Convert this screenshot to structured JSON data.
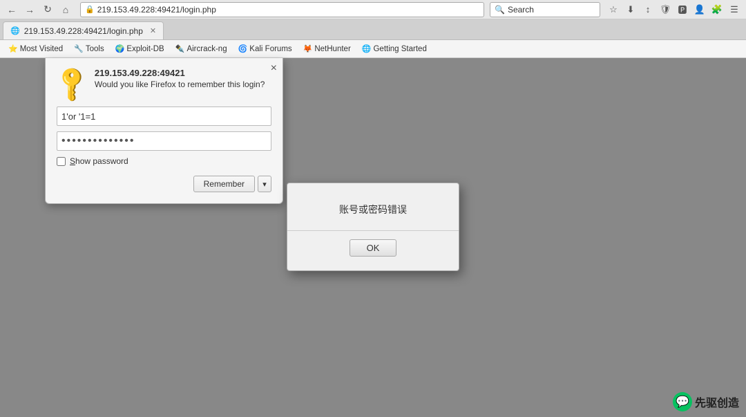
{
  "browser": {
    "address": "219.153.49.228:49421/login.php",
    "tab_title": "219.153.49.228:49421/login.php",
    "tab_favicon": "🌐"
  },
  "nav_buttons": [
    "←",
    "→",
    "↺",
    "🏠"
  ],
  "search": {
    "placeholder": "Search"
  },
  "bookmarks": [
    {
      "id": "most-visited",
      "label": "Most Visited",
      "icon": "⭐"
    },
    {
      "id": "tools",
      "label": "Tools",
      "icon": "🔧"
    },
    {
      "id": "exploit-db",
      "label": "Exploit-DB",
      "icon": "🌍"
    },
    {
      "id": "aircrack-ng",
      "label": "Aircrack-ng",
      "icon": "✒️"
    },
    {
      "id": "kali-forums",
      "label": "Kali Forums",
      "icon": "🌀"
    },
    {
      "id": "nethunter",
      "label": "NetHunter",
      "icon": "🦊"
    },
    {
      "id": "getting-started",
      "label": "Getting Started",
      "icon": "🌐"
    }
  ],
  "password_popup": {
    "domain": "219.153.49.228:49421",
    "question": "Would you like Firefox to remember this login?",
    "username_value": "1'or '1=1",
    "password_value": "••••••••••",
    "show_password_label": "Show password",
    "remember_button": "Remember",
    "close_icon": "×"
  },
  "alert_dialog": {
    "message": "账号或密码错误",
    "ok_button": "OK"
  },
  "watermark": {
    "text": "先驱创造"
  }
}
